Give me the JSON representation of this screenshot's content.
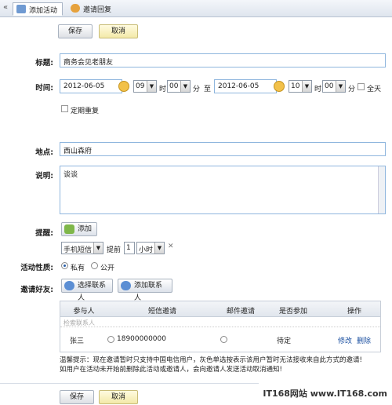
{
  "tabs": {
    "back": "«",
    "items": [
      {
        "label": "添加活动"
      },
      {
        "label": "邀请回复"
      }
    ]
  },
  "toolbar": {
    "save_label": "保存",
    "cancel_label": "取消"
  },
  "form": {
    "title_label": "标题:",
    "title_value": "商务会见老朋友",
    "time_label": "时间:",
    "start_date": "2012-06-05",
    "start_hour": "09",
    "hour_unit": "时",
    "start_minute": "00",
    "minute_unit": "分",
    "to_label": "至",
    "end_date": "2012-06-05",
    "end_hour": "10",
    "end_minute": "00",
    "all_day_label": "全天",
    "repeat_label": "定期重复",
    "location_label": "地点:",
    "location_value": "西山森府",
    "desc_label": "说明:",
    "desc_value": "谈谈",
    "reminder_label": "提醒:",
    "add_label": "添加",
    "reminder_type": "手机短信",
    "advance_label": "提前",
    "advance_value": "1",
    "advance_unit": "小时",
    "remove_icon": "✕",
    "nature_label": "活动性质:",
    "private_label": "私有",
    "public_label": "公开",
    "invite_label": "邀请好友:",
    "select_contact_label": "选择联系人",
    "add_contact_label": "添加联系人"
  },
  "table": {
    "headers": [
      "参与人",
      "短信邀请",
      "邮件邀请",
      "是否参加",
      "操作"
    ],
    "filter_placeholder": "检索联系人",
    "rows": [
      {
        "name": "张三",
        "phone": "18900000000",
        "status": "待定",
        "edit": "修改",
        "delete": "删除"
      }
    ]
  },
  "tip": {
    "line1": "温馨提示：现在邀请暂时只支持中国电信用户，灰色单选按表示该用户暂时无法接收来自此方式的邀请!",
    "line2": "如用户在活动未开始前删除此活动或邀请人，会向邀请人发送活动取消通知!"
  },
  "watermark": "IT168网站 www.IT168.com"
}
